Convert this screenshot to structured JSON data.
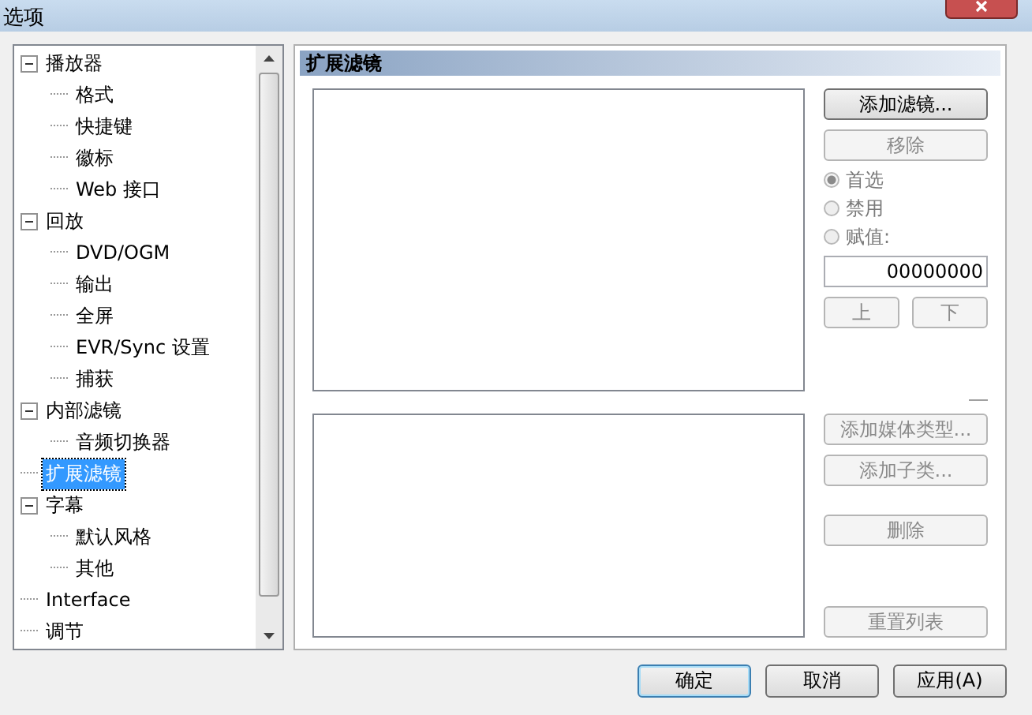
{
  "window": {
    "title": "选项"
  },
  "tree": [
    {
      "label": "播放器",
      "selected": false,
      "expanded": true,
      "children": [
        {
          "label": "格式",
          "selected": false
        },
        {
          "label": "快捷键",
          "selected": false
        },
        {
          "label": "徽标",
          "selected": false
        },
        {
          "label": "Web 接口",
          "selected": false
        }
      ]
    },
    {
      "label": "回放",
      "selected": false,
      "expanded": true,
      "children": [
        {
          "label": "DVD/OGM",
          "selected": false
        },
        {
          "label": "输出",
          "selected": false
        },
        {
          "label": "全屏",
          "selected": false
        },
        {
          "label": "EVR/Sync 设置",
          "selected": false
        },
        {
          "label": "捕获",
          "selected": false
        }
      ]
    },
    {
      "label": "内部滤镜",
      "selected": false,
      "expanded": true,
      "children": [
        {
          "label": "音频切换器",
          "selected": false
        }
      ]
    },
    {
      "label": "扩展滤镜",
      "selected": true
    },
    {
      "label": "字幕",
      "selected": false,
      "expanded": true,
      "children": [
        {
          "label": "默认风格",
          "selected": false
        },
        {
          "label": "其他",
          "selected": false
        }
      ]
    },
    {
      "label": "Interface",
      "selected": false
    },
    {
      "label": "调节",
      "selected": false
    }
  ],
  "panel": {
    "title": "扩展滤镜",
    "filter_buttons": [
      {
        "label": "添加滤镜...",
        "disabled": false
      },
      {
        "label": "移除",
        "disabled": true
      }
    ],
    "radios": [
      {
        "label": "首选",
        "selected": true,
        "disabled": true
      },
      {
        "label": "禁用",
        "selected": false,
        "disabled": true
      },
      {
        "label": "赋值:",
        "selected": false,
        "disabled": true
      }
    ],
    "merit_value": "00000000",
    "move_buttons": [
      {
        "label": "上",
        "disabled": true
      },
      {
        "label": "下",
        "disabled": true
      }
    ],
    "type_buttons": [
      {
        "label": "添加媒体类型...",
        "disabled": true
      },
      {
        "label": "添加子类...",
        "disabled": true
      },
      {
        "label": "删除",
        "disabled": true
      }
    ],
    "reset_button": {
      "label": "重置列表",
      "disabled": true
    }
  },
  "buttons": [
    {
      "label": "确定",
      "default": true
    },
    {
      "label": "取消",
      "default": false
    },
    {
      "label": "应用(A)",
      "default": false
    }
  ]
}
